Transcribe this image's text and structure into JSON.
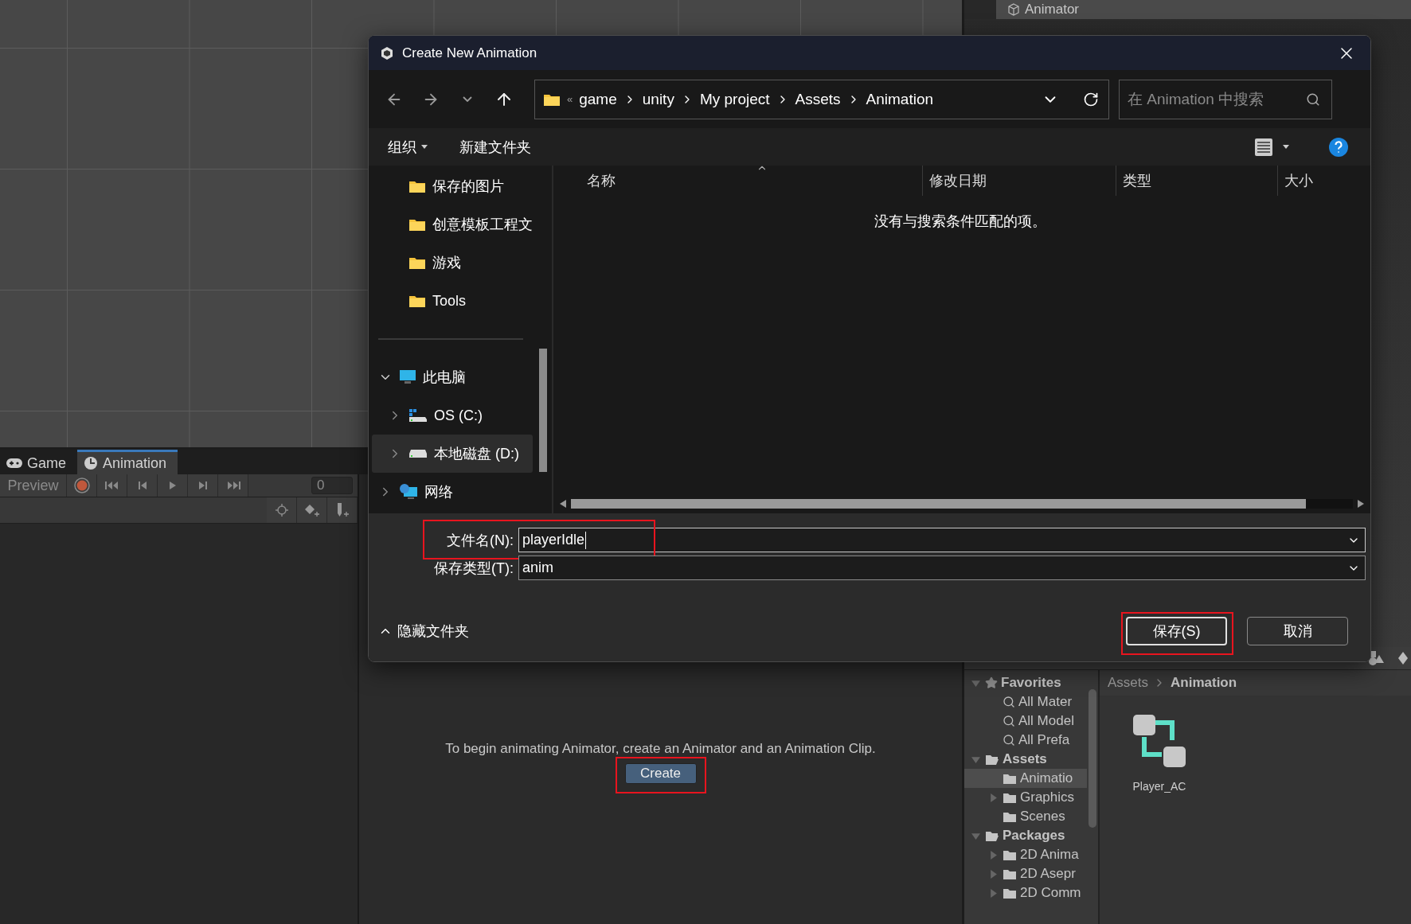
{
  "editor": {
    "animator_tab": {
      "label": "Animator"
    },
    "animation_window": {
      "tabs": [
        {
          "label": "Game",
          "selected": false
        },
        {
          "label": "Animation",
          "selected": true
        }
      ],
      "preview_button": "Preview",
      "frame_field": "0",
      "message": "To begin animating Animator, create an Animator and an Animation Clip.",
      "create_button": {
        "label": "Create",
        "highlighted": true
      }
    },
    "project": {
      "tree": [
        {
          "label": "Favorites",
          "kind": "star",
          "expanded": true,
          "selected": false,
          "children": [
            {
              "label": "All Mater",
              "kind": "search",
              "selected": false
            },
            {
              "label": "All Model",
              "kind": "search",
              "selected": false
            },
            {
              "label": "All Prefa",
              "kind": "search",
              "selected": false
            }
          ]
        },
        {
          "label": "Assets",
          "kind": "open-folder",
          "expanded": true,
          "selected": false,
          "children": [
            {
              "label": "Animatio",
              "kind": "folder",
              "selected": true
            },
            {
              "label": "Graphics",
              "kind": "folder",
              "expanded": false,
              "selected": false
            },
            {
              "label": "Scenes",
              "kind": "folder",
              "selected": false
            }
          ]
        },
        {
          "label": "Packages",
          "kind": "open-folder",
          "expanded": true,
          "selected": false,
          "children": [
            {
              "label": "2D Anima",
              "kind": "folder",
              "expanded": false,
              "selected": false
            },
            {
              "label": "2D Asepr",
              "kind": "folder",
              "expanded": false,
              "selected": false
            },
            {
              "label": "2D Comm",
              "kind": "folder",
              "expanded": false,
              "selected": false
            }
          ]
        }
      ],
      "breadcrumb": [
        {
          "label": "Assets",
          "current": false
        },
        {
          "label": "Animation",
          "current": true
        }
      ],
      "assets": [
        {
          "name": "Player_AC",
          "kind": "animator-controller"
        }
      ]
    }
  },
  "dialog": {
    "title": "Create New Animation",
    "address": {
      "overflow": "«",
      "segments": [
        "game",
        "unity",
        "My project",
        "Assets",
        "Animation"
      ]
    },
    "search": {
      "placeholder": "在 Animation 中搜索"
    },
    "commands": [
      {
        "label": "组织",
        "menu": true
      },
      {
        "label": "新建文件夹",
        "menu": false
      }
    ],
    "nav": {
      "quick_access": [
        {
          "label": "保存的图片",
          "selected": false
        },
        {
          "label": "创意模板工程文",
          "selected": false
        },
        {
          "label": "游戏",
          "selected": false
        },
        {
          "label": "Tools",
          "selected": false
        }
      ],
      "tree": [
        {
          "label": "此电脑",
          "kind": "pc",
          "expanded": true,
          "selected": false,
          "children": [
            {
              "label": "OS (C:)",
              "kind": "system-drive",
              "expanded": false,
              "selected": false
            },
            {
              "label": "本地磁盘 (D:)",
              "kind": "drive",
              "expanded": false,
              "selected": true
            }
          ]
        },
        {
          "label": "网络",
          "kind": "network",
          "expanded": false,
          "selected": false
        }
      ]
    },
    "columns": [
      {
        "label": "名称",
        "sorted": true
      },
      {
        "label": "修改日期",
        "sorted": false
      },
      {
        "label": "类型",
        "sorted": false
      },
      {
        "label": "大小",
        "sorted": false
      }
    ],
    "empty_message": "没有与搜索条件匹配的项。",
    "fields": [
      {
        "label": "文件名(N):",
        "value": "playerIdle",
        "focused": true,
        "highlighted": true
      },
      {
        "label": "保存类型(T):",
        "value": "anim",
        "focused": false,
        "highlighted": false
      }
    ],
    "hide_folders": "隐藏文件夹",
    "buttons": [
      {
        "label": "保存(S)",
        "primary": true,
        "highlighted": true
      },
      {
        "label": "取消",
        "primary": false,
        "highlighted": false
      }
    ]
  }
}
